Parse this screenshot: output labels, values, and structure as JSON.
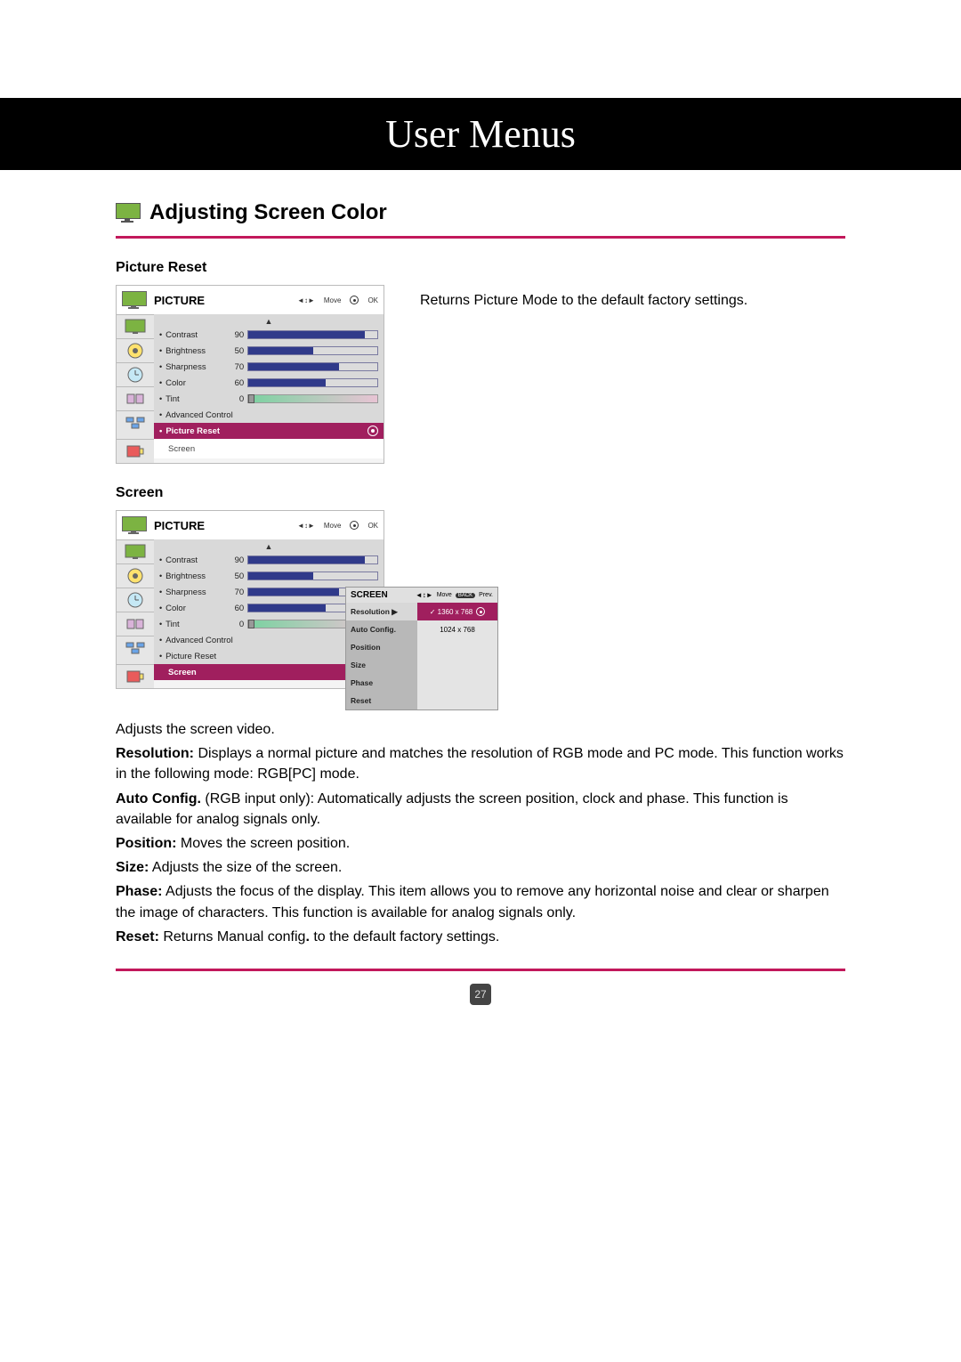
{
  "page_title": "User Menus",
  "section_title": "Adjusting Screen Color",
  "sub1_heading": "Picture Reset",
  "sub2_heading": "Screen",
  "osd_title": "PICTURE",
  "osd_move": "Move",
  "osd_ok": "OK",
  "scroll_arrow": "▲",
  "settings": {
    "contrast": {
      "label": "Contrast",
      "value": "90",
      "pct": 90
    },
    "brightness": {
      "label": "Brightness",
      "value": "50",
      "pct": 50
    },
    "sharpness": {
      "label": "Sharpness",
      "value": "70",
      "pct": 70
    },
    "color": {
      "label": "Color",
      "value": "60",
      "pct": 60
    },
    "tint": {
      "label": "Tint",
      "value": "0"
    },
    "advanced": {
      "label": "Advanced Control"
    },
    "picture_reset": {
      "label": "Picture Reset"
    },
    "screen": {
      "label": "Screen"
    }
  },
  "bullet_prefix": "•",
  "reset_desc": "Returns Picture Mode to  the default factory settings.",
  "submenu": {
    "title": "SCREEN",
    "move": "Move",
    "back": "BACK",
    "prev": "Prev.",
    "items": {
      "resolution": "Resolution ▶",
      "auto": "Auto Config.",
      "position": "Position",
      "size": "Size",
      "phase": "Phase",
      "reset": "Reset"
    },
    "res1": "✓ 1360 x 768",
    "res2": "1024 x 768"
  },
  "desc": {
    "intro": "Adjusts the screen video.",
    "resolution_label": "Resolution:",
    "resolution_text": " Displays a normal picture and matches the resolution of RGB mode and PC mode. This function works in the following mode: RGB[PC] mode.",
    "auto_label": "Auto Config.",
    "auto_text": " (RGB input only): Automatically adjusts the screen position, clock and phase. This function is available for analog signals only.",
    "position_label": "Position:",
    "position_text": " Moves the screen position.",
    "size_label": "Size:",
    "size_text": " Adjusts the size of the screen.",
    "phase_label": "Phase:",
    "phase_text": " Adjusts the focus of the display. This item allows you to remove any horizontal noise and clear or sharpen the image of characters. This function is available for analog signals only.",
    "reset_label": "Reset:",
    "reset_text": " Returns Manual config",
    "reset_text2": " to the default factory settings."
  },
  "page_number": "27"
}
